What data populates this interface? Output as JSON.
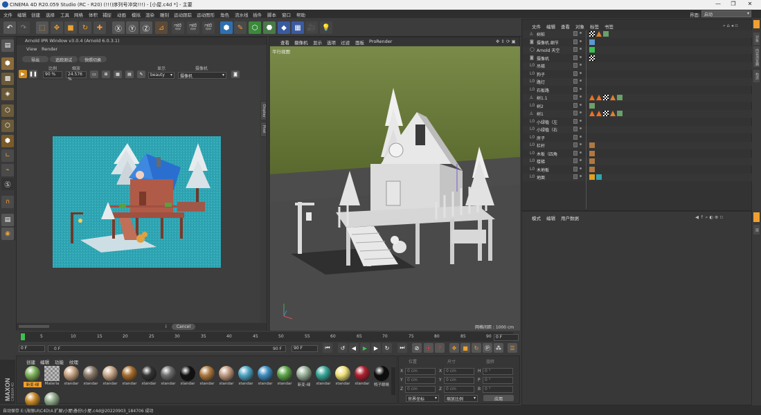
{
  "window": {
    "title": "CINEMA 4D R20.059 Studio (RC - R20) (!!!)序列号冲突!!!) - [小屋.c4d *] - 主要",
    "controls": [
      "—",
      "❐",
      "✕"
    ]
  },
  "menubar": {
    "items": [
      "文件",
      "编辑",
      "创建",
      "选择",
      "工具",
      "网格",
      "体积",
      "捕捉",
      "动画",
      "模拟",
      "渲染",
      "雕刻",
      "运动跟踪",
      "运动图形",
      "角色",
      "流水线",
      "插件",
      "脚本",
      "窗口",
      "帮助"
    ],
    "layout_label": "界面:",
    "layout_value": "启动"
  },
  "ipr": {
    "title": "Arnold IPR Window v3.0.4 (Arnold 6.0.3.1)",
    "menu": [
      "View",
      "Render"
    ],
    "buttons": [
      "导出",
      "追踪测试",
      "快照切换"
    ],
    "ratio_label": "比例",
    "ratio_value": "90 %",
    "zoom_label": "缩放",
    "zoom_value": "24.576 %",
    "display_label": "显示",
    "display_value": "beauty",
    "camera_label": "摄像机",
    "camera_value": "摄像机",
    "side_tabs": [
      "Display",
      "Pixel"
    ],
    "cancel": "Cancel",
    "info": "i"
  },
  "viewport": {
    "menu": [
      "查看",
      "摄像机",
      "显示",
      "选项",
      "过滤",
      "面板",
      "ProRender"
    ],
    "view_name": "平行视图",
    "grid_info": "网格间距 : 1000 cm"
  },
  "timeline": {
    "ticks": [
      "0",
      "5",
      "10",
      "15",
      "20",
      "25",
      "30",
      "35",
      "40",
      "45",
      "50",
      "55",
      "60",
      "65",
      "70",
      "75",
      "80",
      "85",
      "90"
    ],
    "current_frame": "0 F",
    "start_frame": "0 F",
    "range_start": "0 F",
    "range_end": "90 F",
    "end_frame": "90 F"
  },
  "materials": {
    "tabs": [
      "创建",
      "编辑",
      "功能",
      "纹理"
    ],
    "items": [
      {
        "name": "新变-绿",
        "color": "#7fb35a"
      },
      {
        "name": "Materia",
        "color": "#9a9a9a"
      },
      {
        "name": "standar",
        "color": "#c9a583"
      },
      {
        "name": "standar",
        "color": "#8a7a6a"
      },
      {
        "name": "standar",
        "color": "#caa88a"
      },
      {
        "name": "standar",
        "color": "#a86e2e"
      },
      {
        "name": "standar",
        "color": "#333333"
      },
      {
        "name": "standar",
        "color": "#6e6e6e"
      },
      {
        "name": "standar",
        "color": "#111111"
      },
      {
        "name": "standar",
        "color": "#b07a40"
      },
      {
        "name": "standar",
        "color": "#c29a80"
      },
      {
        "name": "standar",
        "color": "#4fa7c7"
      },
      {
        "name": "standar",
        "color": "#3f8fc2"
      },
      {
        "name": "standar",
        "color": "#5fa84a"
      },
      {
        "name": "新变-绿",
        "color": "#9bb29b"
      },
      {
        "name": "standar",
        "color": "#3aa89a"
      },
      {
        "name": "standar",
        "color": "#f0e27a"
      },
      {
        "name": "standar",
        "color": "#b02030"
      },
      {
        "name": "鸭子眼睛",
        "color": "#0c0c0c"
      },
      {
        "name": "",
        "color": "#c88a2a"
      },
      {
        "name": "",
        "color": "#8faa8a"
      }
    ]
  },
  "coords": {
    "header": [
      "位置",
      "尺寸",
      "旋转"
    ],
    "rows": [
      {
        "a": "X",
        "av": "0 cm",
        "b": "X",
        "bv": "0 cm",
        "c": "H",
        "cv": "0 °"
      },
      {
        "a": "Y",
        "av": "0 cm",
        "b": "Y",
        "bv": "0 cm",
        "c": "P",
        "cv": "0 °"
      },
      {
        "a": "Z",
        "av": "0 cm",
        "b": "Z",
        "bv": "0 cm",
        "c": "B",
        "cv": "0 °"
      }
    ],
    "mode1": "世界坐标",
    "mode2": "缩放比例",
    "apply": "应用"
  },
  "status": {
    "text": "自动保存 E:\\海丽UI\\C4D\\4.扩展\\小屋\\备份\\小屋.c4d@20220903_184706 成功"
  },
  "objects": {
    "tabs": [
      "文件",
      "编辑",
      "查看",
      "对象",
      "标签",
      "书签"
    ],
    "rows": [
      {
        "name": "树桩",
        "icon": "tree"
      },
      {
        "name": "摄像机.细节",
        "icon": "cam"
      },
      {
        "name": "Arnold 天空",
        "icon": "sky"
      },
      {
        "name": "摄像机",
        "icon": "cam"
      },
      {
        "name": "吊梯",
        "icon": "null"
      },
      {
        "name": "狗子",
        "icon": "null"
      },
      {
        "name": "路灯",
        "icon": "null"
      },
      {
        "name": "石板路",
        "icon": "null"
      },
      {
        "name": "树1.1",
        "icon": "tree"
      },
      {
        "name": "树2",
        "icon": "null"
      },
      {
        "name": "树1",
        "icon": "tree"
      },
      {
        "name": "小绿植（左",
        "icon": "null"
      },
      {
        "name": "小绿植（右",
        "icon": "null"
      },
      {
        "name": "房子",
        "icon": "null"
      },
      {
        "name": "栏杆",
        "icon": "null"
      },
      {
        "name": "木板（四角",
        "icon": "null"
      },
      {
        "name": "楼梯",
        "icon": "null"
      },
      {
        "name": "木地板",
        "icon": "null"
      },
      {
        "name": "地面",
        "icon": "null"
      }
    ]
  },
  "attributes": {
    "tabs": [
      "模式",
      "编辑",
      "用户数据"
    ]
  },
  "right_strip": [
    "对象",
    "内容浏览器",
    "构造",
    "层"
  ],
  "colors": {
    "bg": "#3a3a3a",
    "accent": "#f0a030",
    "viewport_sky": "#6b7a3a",
    "viewport_floor": "#4a4a4a",
    "render_bg": "#2fa5b3"
  }
}
